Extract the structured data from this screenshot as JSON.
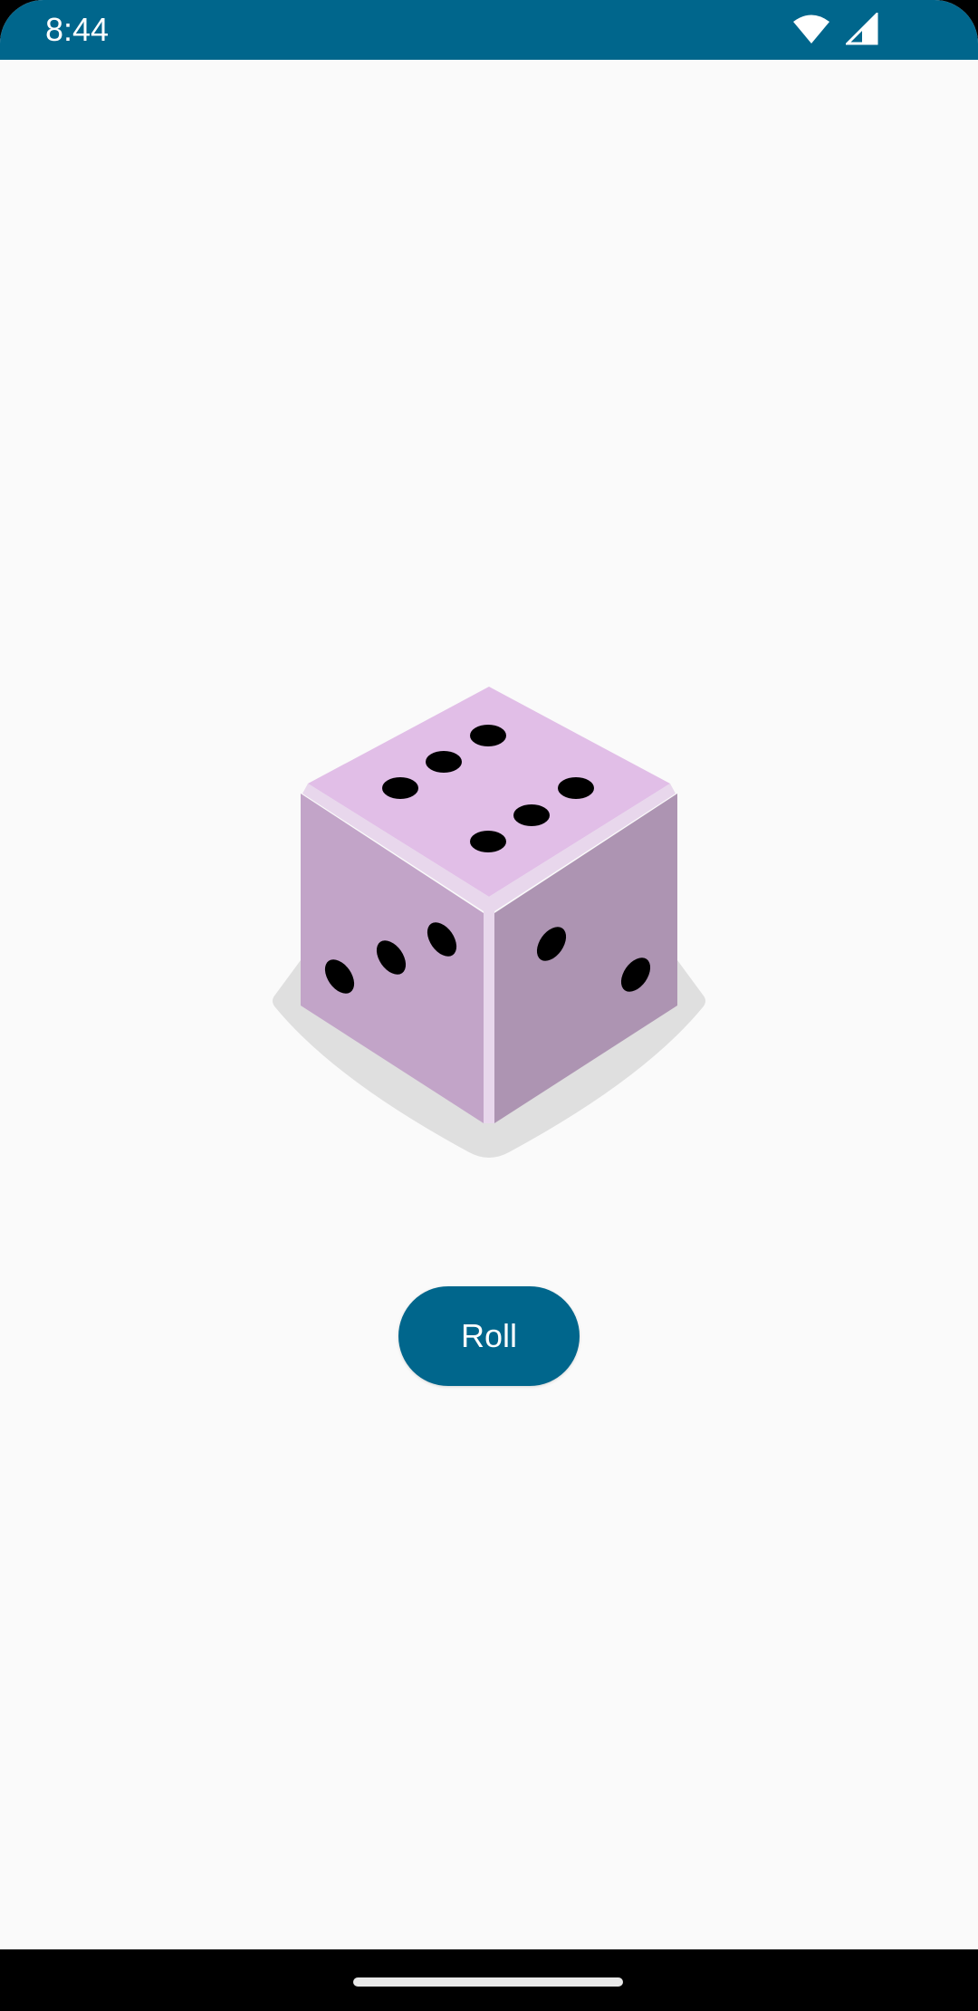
{
  "status_bar": {
    "time": "8:44",
    "icons": [
      "wifi-icon",
      "cellular-signal-icon"
    ],
    "background_color": "#00668c"
  },
  "dice": {
    "icon": "dice-icon",
    "top_face_pips": 6,
    "left_face_pips": 3,
    "right_face_pips": 2,
    "colors": {
      "top": "#e1bee7",
      "left": "#c2a4c8",
      "right": "#ad94b2",
      "edge": "#e8d7ec",
      "shadow": "#dfdfdf",
      "pip": "#000000"
    }
  },
  "roll_button": {
    "label": "Roll",
    "color": "#00668c"
  },
  "navigation_bar": {
    "handle": "home-gesture-handle"
  }
}
